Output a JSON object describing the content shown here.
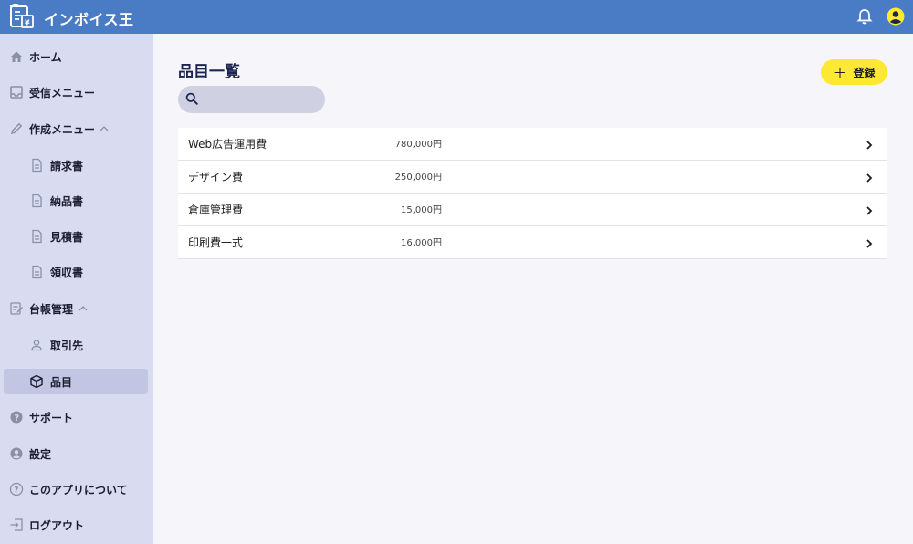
{
  "app": {
    "title": "インボイス王"
  },
  "sidebar": {
    "items": [
      {
        "label": "ホーム",
        "icon": "home-icon"
      },
      {
        "label": "受信メニュー",
        "icon": "inbox-icon"
      },
      {
        "label": "作成メニュー",
        "icon": "pencil-icon",
        "expanded": true
      },
      {
        "label": "請求書",
        "icon": "document-icon"
      },
      {
        "label": "納品書",
        "icon": "document-icon"
      },
      {
        "label": "見積書",
        "icon": "document-icon"
      },
      {
        "label": "領収書",
        "icon": "document-icon"
      },
      {
        "label": "台帳管理",
        "icon": "ledger-icon",
        "expanded": true
      },
      {
        "label": "取引先",
        "icon": "person-icon"
      },
      {
        "label": "品目",
        "icon": "box-icon",
        "active": true
      },
      {
        "label": "サポート",
        "icon": "help-icon"
      },
      {
        "label": "設定",
        "icon": "account-icon"
      },
      {
        "label": "このアプリについて",
        "icon": "question-icon"
      },
      {
        "label": "ログアウト",
        "icon": "logout-icon"
      }
    ]
  },
  "main": {
    "title": "品目一覧",
    "search": {
      "value": "",
      "placeholder": ""
    },
    "add_label": "登録",
    "items": [
      {
        "name": "Web広告運用費",
        "price": "780,000円"
      },
      {
        "name": "デザイン費",
        "price": "250,000円"
      },
      {
        "name": "倉庫管理費",
        "price": "15,000円"
      },
      {
        "name": "印刷費一式",
        "price": "16,000円"
      }
    ]
  },
  "colors": {
    "header": "#4a7cc6",
    "sidebar": "#d9dcf1",
    "accent": "#fde933",
    "title": "#1b2550"
  }
}
